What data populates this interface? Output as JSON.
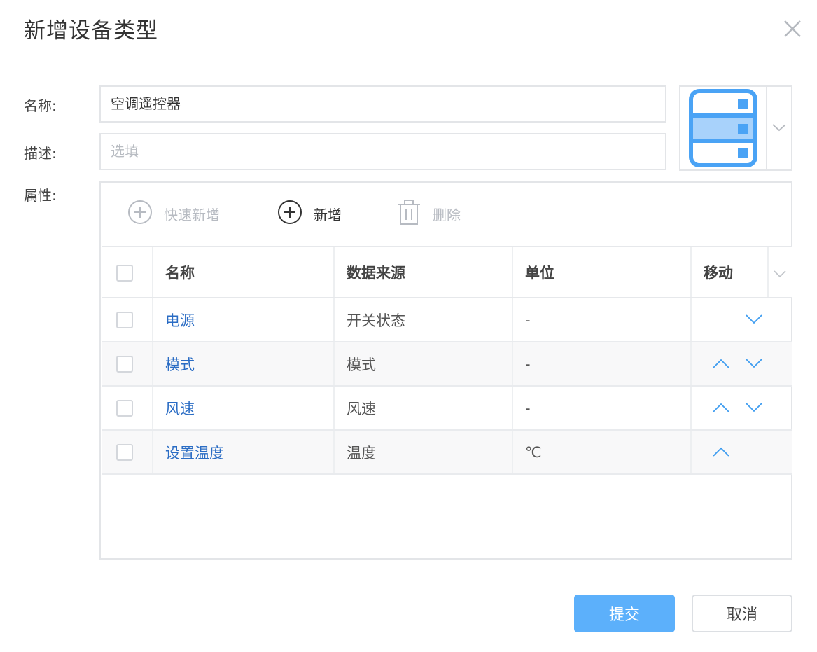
{
  "dialog": {
    "title": "新增设备类型",
    "close_icon": "close-icon"
  },
  "form": {
    "name_label": "名称:",
    "name_value": "空调遥控器",
    "desc_label": "描述:",
    "desc_placeholder": "选填",
    "attr_label": "属性:",
    "device_icon": "server-icon",
    "icon_color": "#4aa3f5"
  },
  "toolbar": {
    "quick_add_label": "快速新增",
    "add_label": "新增",
    "delete_label": "删除"
  },
  "table": {
    "columns": [
      "名称",
      "数据来源",
      "单位",
      "移动"
    ],
    "rows": [
      {
        "name": "电源",
        "source": "开关状态",
        "unit": "-",
        "move_up": false,
        "move_down": true
      },
      {
        "name": "模式",
        "source": "模式",
        "unit": "-",
        "move_up": true,
        "move_down": true
      },
      {
        "name": "风速",
        "source": "风速",
        "unit": "-",
        "move_up": true,
        "move_down": true
      },
      {
        "name": "设置温度",
        "source": "温度",
        "unit": "℃",
        "move_up": true,
        "move_down": false
      }
    ]
  },
  "footer": {
    "submit_label": "提交",
    "cancel_label": "取消"
  },
  "colors": {
    "primary": "#5cb0fb",
    "link": "#2a6cc4",
    "arrow": "#3d9cf0"
  }
}
